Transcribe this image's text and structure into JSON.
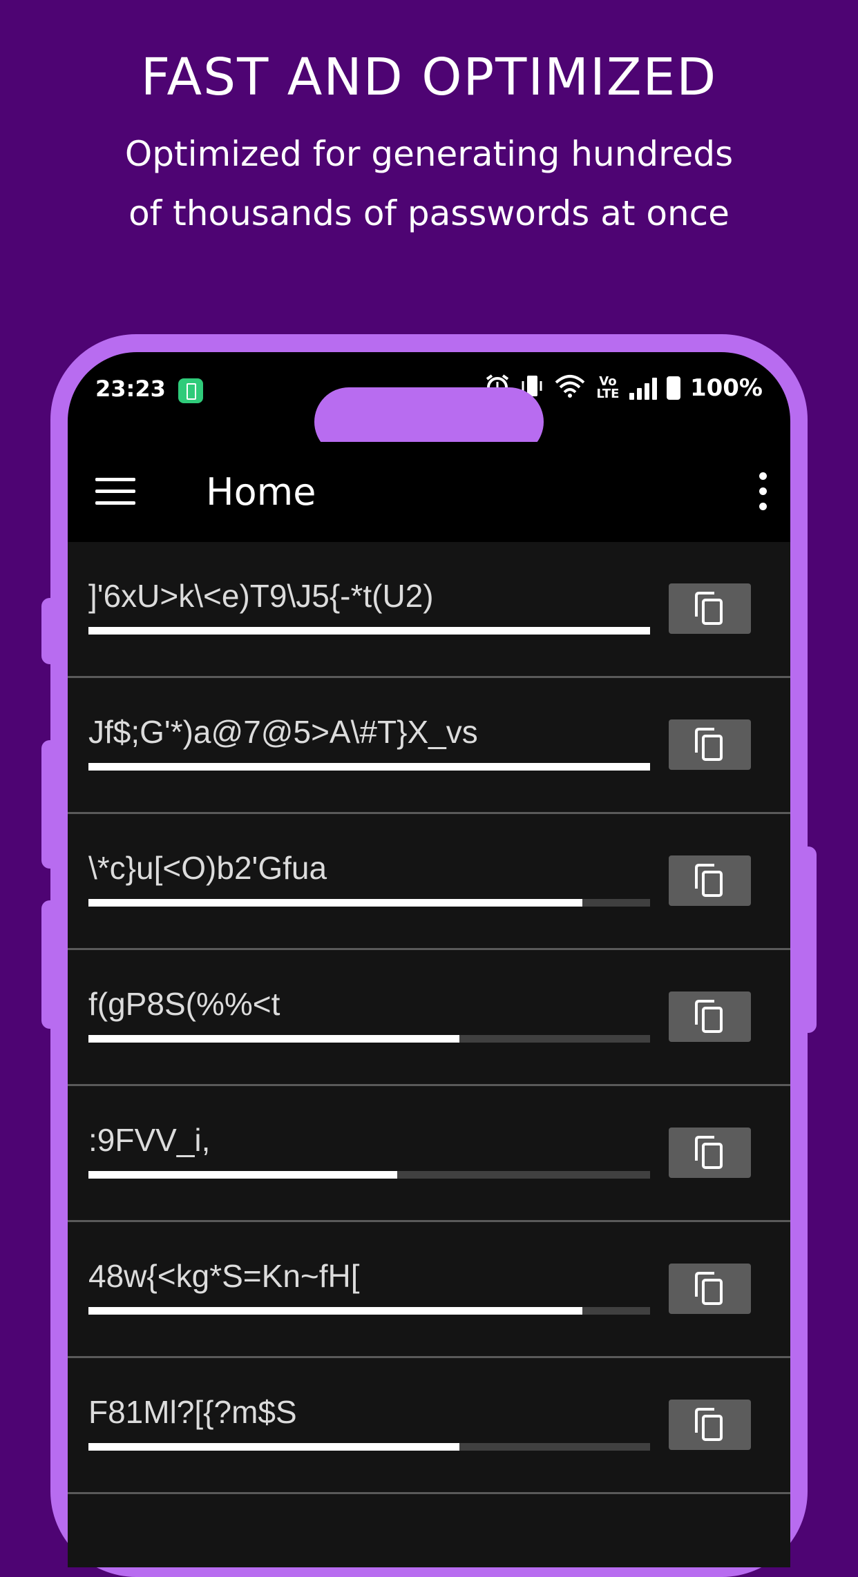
{
  "promo": {
    "headline": "FAST AND OPTIMIZED",
    "subhead_line1": "Optimized for generating hundreds",
    "subhead_line2": "of thousands of passwords at once"
  },
  "colors": {
    "background": "#4E0473",
    "phone_frame": "#B86CF0",
    "list_bg": "#141414",
    "strength_fill": "#ffffff",
    "copy_button": "#5c5c5c"
  },
  "status_bar": {
    "time": "23:23",
    "icons": [
      "battery-saver-icon",
      "alarm-icon",
      "vibrate-icon",
      "wifi-icon",
      "volte-icon",
      "signal-icon",
      "battery-icon"
    ],
    "volte_top": "Vo",
    "volte_bottom": "LTE",
    "battery": "100%"
  },
  "app_bar": {
    "title": "Home",
    "menu_icon": "hamburger-menu-icon",
    "overflow_icon": "more-vert-icon"
  },
  "passwords": [
    {
      "value": "]'6xU>k\\<e)T9\\J5{-*t(U2)",
      "strength": 1.0
    },
    {
      "value": "Jf$;G'*)a@7@5>A\\#T}X_vs",
      "strength": 1.0
    },
    {
      "value": "\\*c}u[<O)b2'Gfua",
      "strength": 0.88
    },
    {
      "value": "f(gP8S(%%<t",
      "strength": 0.66
    },
    {
      "value": ":9FVV_i,",
      "strength": 0.55
    },
    {
      "value": "48w{<kg*S=Kn~fH[",
      "strength": 0.88
    },
    {
      "value": "F81Ml?[{?m$S",
      "strength": 0.66
    }
  ]
}
